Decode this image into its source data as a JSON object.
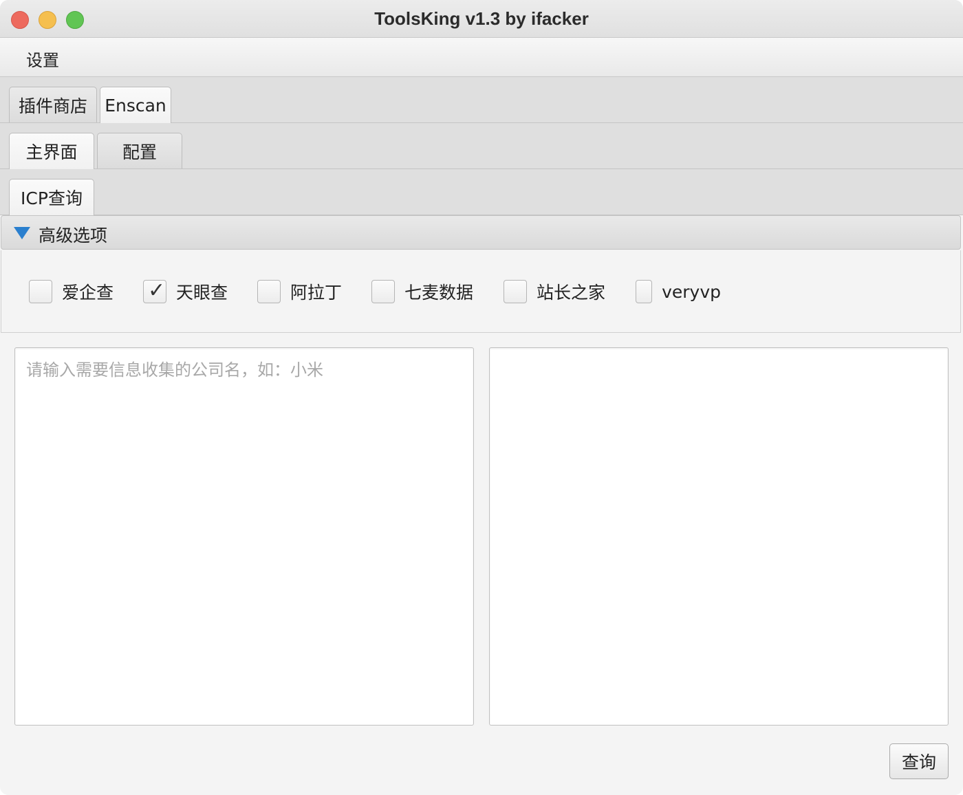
{
  "window": {
    "title": "ToolsKing v1.3 by ifacker"
  },
  "menubar": {
    "items": [
      {
        "label": "设置"
      }
    ]
  },
  "plugin_tabs": [
    {
      "label": "插件商店",
      "active": false
    },
    {
      "label": "Enscan",
      "active": true
    }
  ],
  "sub_tabs": [
    {
      "label": "主界面",
      "active": true
    },
    {
      "label": "配置",
      "active": false
    }
  ],
  "query_tabs": [
    {
      "label": "ICP查询",
      "active": true
    }
  ],
  "advanced": {
    "title": "高级选项",
    "expanded": true,
    "sources": [
      {
        "label": "爱企查",
        "checked": false
      },
      {
        "label": "天眼查",
        "checked": true
      },
      {
        "label": "阿拉丁",
        "checked": false
      },
      {
        "label": "七麦数据",
        "checked": false
      },
      {
        "label": "站长之家",
        "checked": false
      },
      {
        "label": "veryvp",
        "checked": false
      }
    ]
  },
  "input": {
    "placeholder": "请输入需要信息收集的公司名，如：小米",
    "value": ""
  },
  "output": {
    "value": ""
  },
  "actions": {
    "query_label": "查询"
  },
  "colors": {
    "accent": "#2a7fce",
    "close": "#ed6a5e",
    "minimize": "#f5bf4f",
    "maximize": "#61c554"
  }
}
